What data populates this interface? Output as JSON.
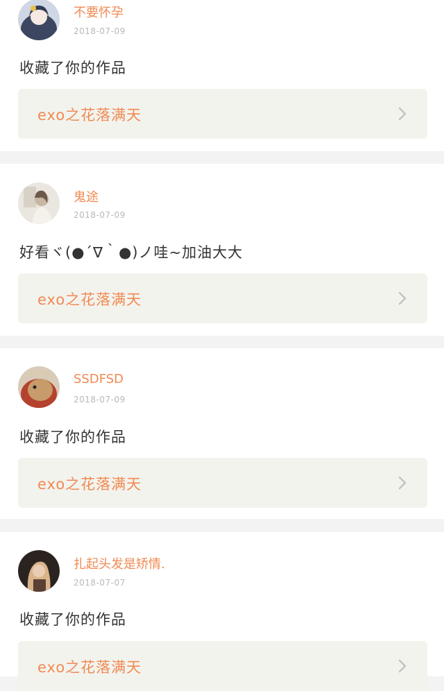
{
  "items": [
    {
      "username": "不要怀孕",
      "date": "2018-07-09",
      "content": "收藏了你的作品",
      "work_title": "exo之花落满天",
      "avatar_icon": "avatar-girl-illustration"
    },
    {
      "username": "鬼途",
      "date": "2018-07-09",
      "content": "好看ヾ(●´∇｀●)ノ哇~加油大大",
      "work_title": "exo之花落满天",
      "avatar_icon": "avatar-girl-photo"
    },
    {
      "username": "SSDFSD",
      "date": "2018-07-09",
      "content": "收藏了你的作品",
      "work_title": "exo之花落满天",
      "avatar_icon": "avatar-guinea-pig"
    },
    {
      "username": "扎起头发是矫情.",
      "date": "2018-07-07",
      "content": "收藏了你的作品",
      "work_title": "exo之花落满天",
      "avatar_icon": "avatar-blonde-woman"
    }
  ],
  "colors": {
    "accent": "#f08a52",
    "date": "#b8b8b8",
    "work_bg": "#f3f3ee",
    "divider": "#f3f3f3"
  }
}
